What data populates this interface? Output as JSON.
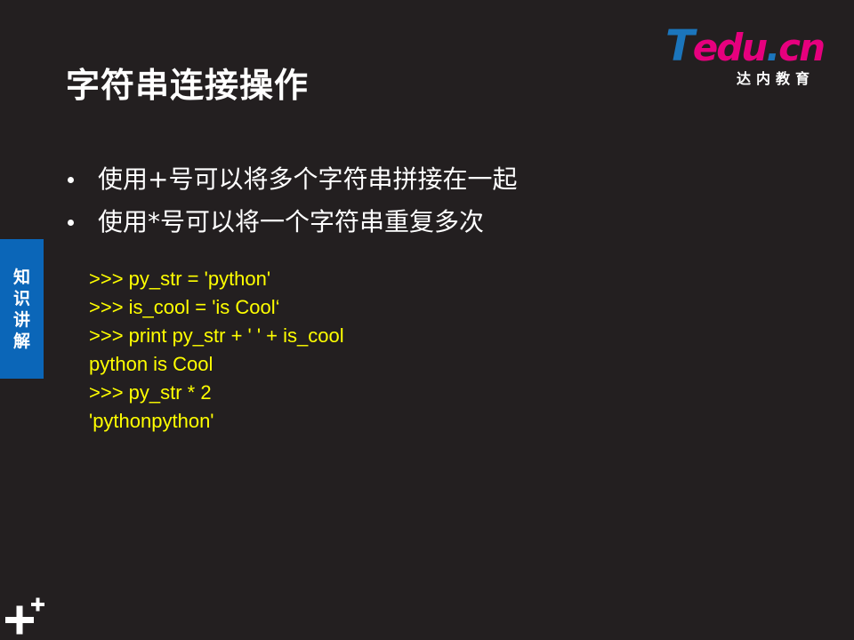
{
  "slide": {
    "title": "字符串连接操作",
    "logo": {
      "mark_t": "T",
      "mark_edu": "edu",
      "mark_dot": ".",
      "mark_cn": "cn",
      "subtitle": "达内教育"
    },
    "bullets": [
      "使用+号可以将多个字符串拼接在一起",
      "使用*号可以将一个字符串重复多次"
    ],
    "code_lines": [
      ">>> py_str = 'python'",
      ">>> is_cool = 'is Cool‘",
      ">>> print py_str + ' ' + is_cool",
      "python is Cool",
      ">>> py_str * 2",
      "'pythonpython'"
    ],
    "side_tab_label": "知识讲解",
    "icons": {
      "corner": "plus-plus-icon",
      "bullet": "bullet-dot-icon"
    },
    "colors": {
      "background": "#231f20",
      "title": "#ffffff",
      "code": "#ffff00",
      "side_tab": "#0b66b8",
      "logo_pink": "#e6007e",
      "logo_blue": "#1b75bc"
    }
  }
}
